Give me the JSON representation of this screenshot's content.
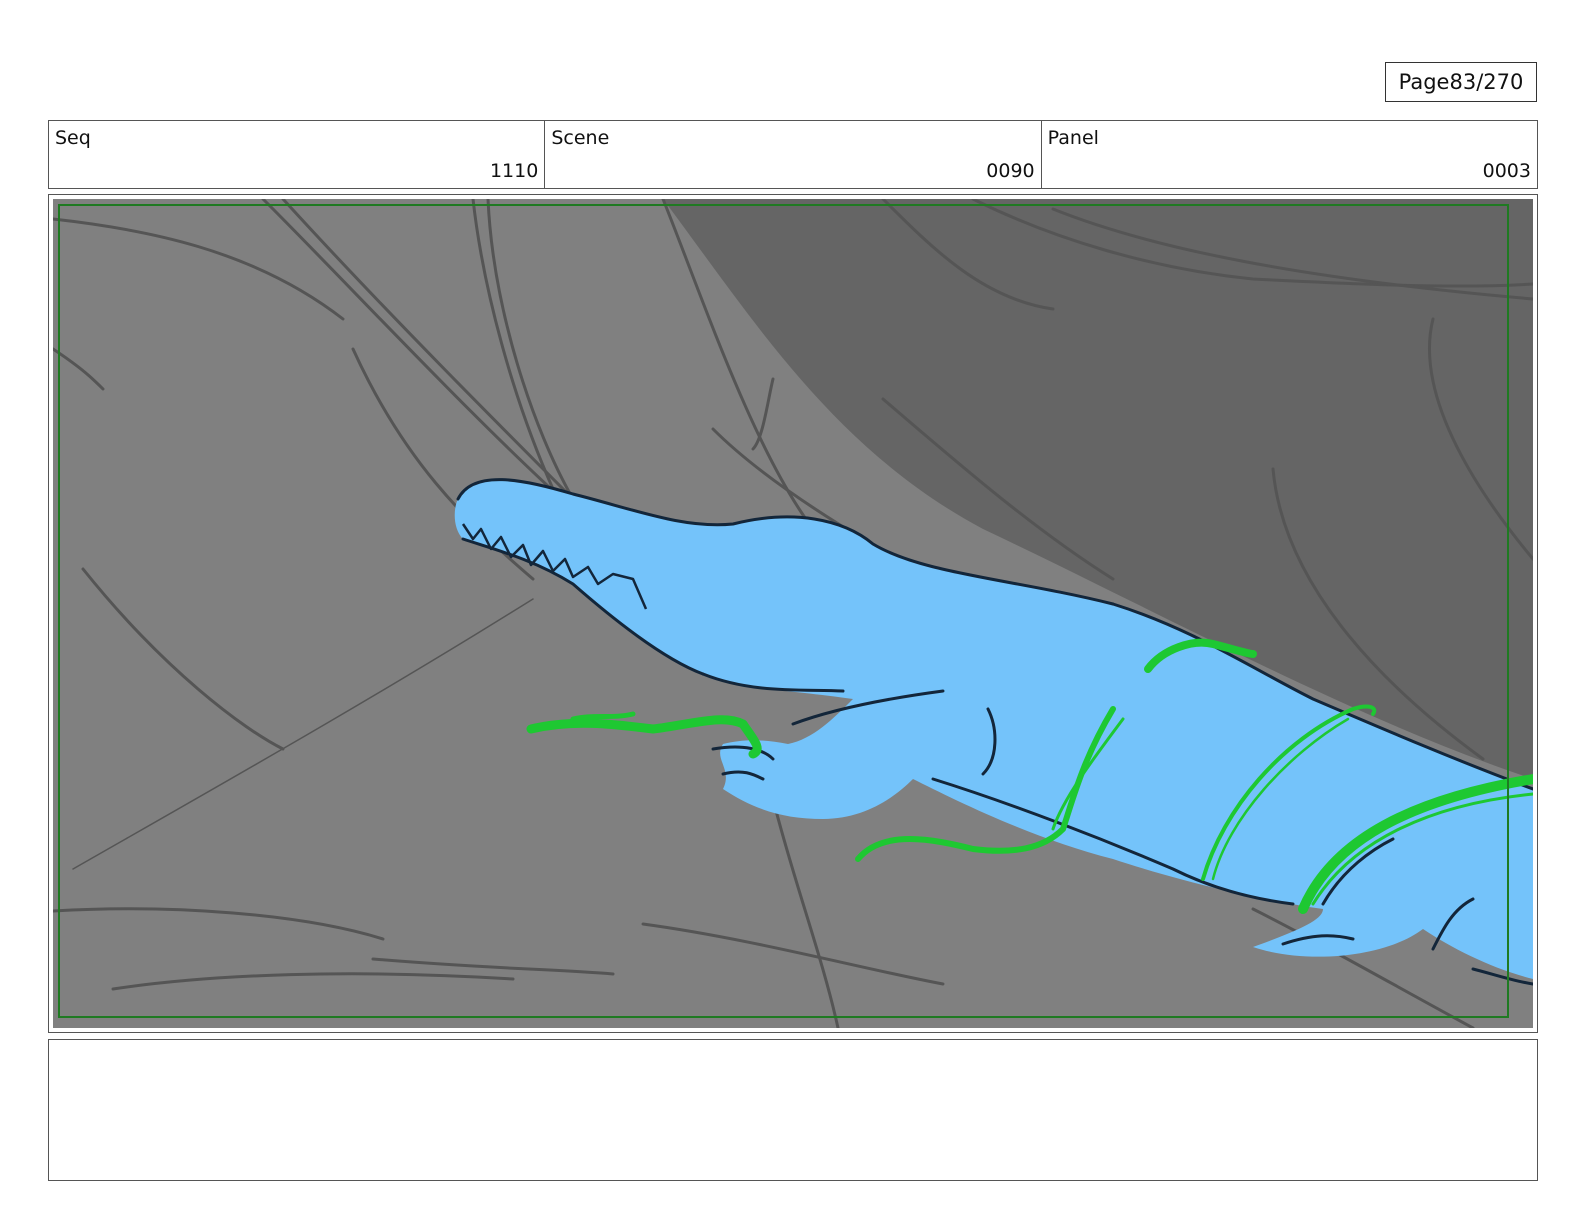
{
  "page": {
    "label": "Page",
    "number": "83/270"
  },
  "header": {
    "seq": {
      "label": "Seq",
      "value": "1110"
    },
    "scene": {
      "label": "Scene",
      "value": "0090"
    },
    "panel": {
      "label": "Panel",
      "value": "0003"
    }
  },
  "notes": {
    "text": ""
  },
  "colors": {
    "background_gray": "#808080",
    "shadow_gray": "#656565",
    "character_blue": "#74c3fa",
    "accent_green": "#1ec832",
    "safe_frame_green": "#1f7a22"
  }
}
